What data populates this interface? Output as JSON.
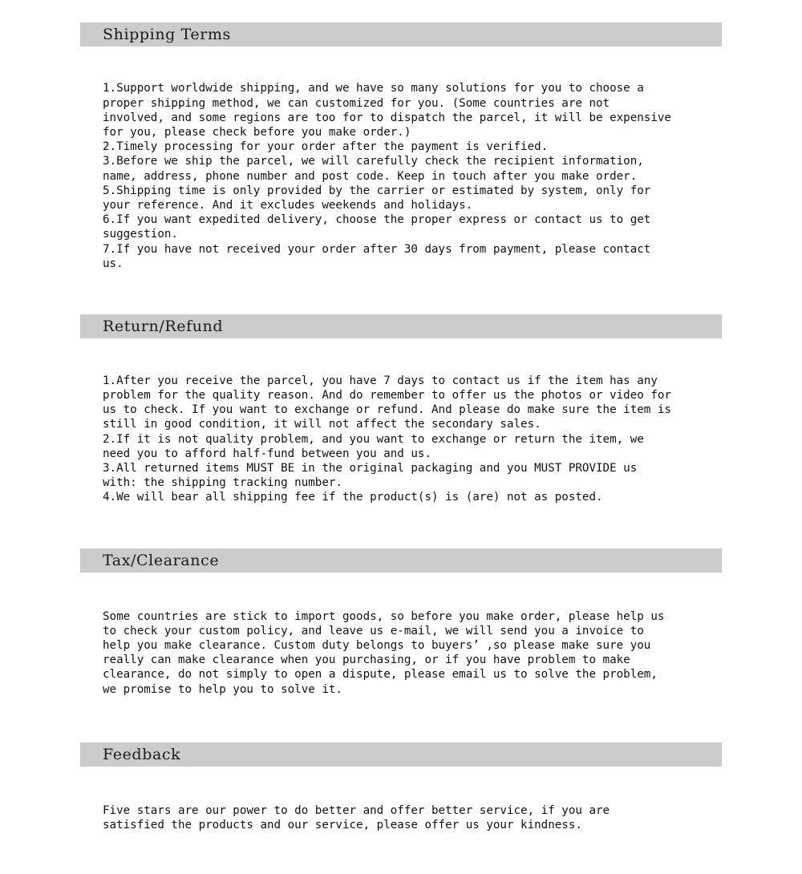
{
  "document": {
    "background_color": "#ffffff",
    "header_bar_color": "#cccccc",
    "text_color": "#111111"
  },
  "sections": [
    {
      "id": "shipping-terms",
      "title": "Shipping Terms",
      "body": "1.Support worldwide shipping, and we have so many solutions for you to choose a\nproper shipping method, we can customized for you. (Some countries are not\ninvolved, and some regions are too for to dispatch the parcel, it will be expensive\nfor you, please check before you make order.)\n2.Timely processing for your order after the payment is verified.\n3.Before we ship the parcel, we will carefully check the recipient information,\nname, address, phone number and post code. Keep in touch after you make order.\n5.Shipping time is only provided by the carrier or estimated by system, only for\nyour reference. And it excludes weekends and holidays.\n6.If you want expedited delivery, choose the proper express or contact us to get\nsuggestion.\n7.If you have not received your order after 30 days from payment, please contact\nus."
    },
    {
      "id": "return-refund",
      "title": "Return/Refund",
      "body": "1.After you receive the parcel, you have 7 days to contact us if the item has any\nproblem for the quality reason. And do remember to offer us the photos or video for\nus to check. If you want to exchange or refund. And please do make sure the item is\nstill in good condition, it will not affect the secondary sales.\n2.If it is not quality problem, and you want to exchange or return the item, we\nneed you to afford half-fund between you and us.\n3.All returned items MUST BE in the original packaging and you MUST PROVIDE us\nwith: the shipping tracking number.\n4.We will bear all shipping fee if the product(s) is (are) not as posted."
    },
    {
      "id": "tax-clearance",
      "title": "Tax/Clearance",
      "body": "Some countries are stick to import goods, so before you make order, please help us\nto check your custom policy, and leave us e-mail, we will send you a invoice to\nhelp you make clearance. Custom duty belongs to buyers’ ,so please make sure you\nreally can make clearance when you purchasing, or if you have problem to make\nclearance, do not simply to open a dispute, please email us to solve the problem,\nwe promise to help you to solve it."
    },
    {
      "id": "feedback",
      "title": "Feedback",
      "body": "Five stars are our power to do better and offer better service, if you are\nsatisfied the products and our service, please offer us your kindness."
    }
  ]
}
